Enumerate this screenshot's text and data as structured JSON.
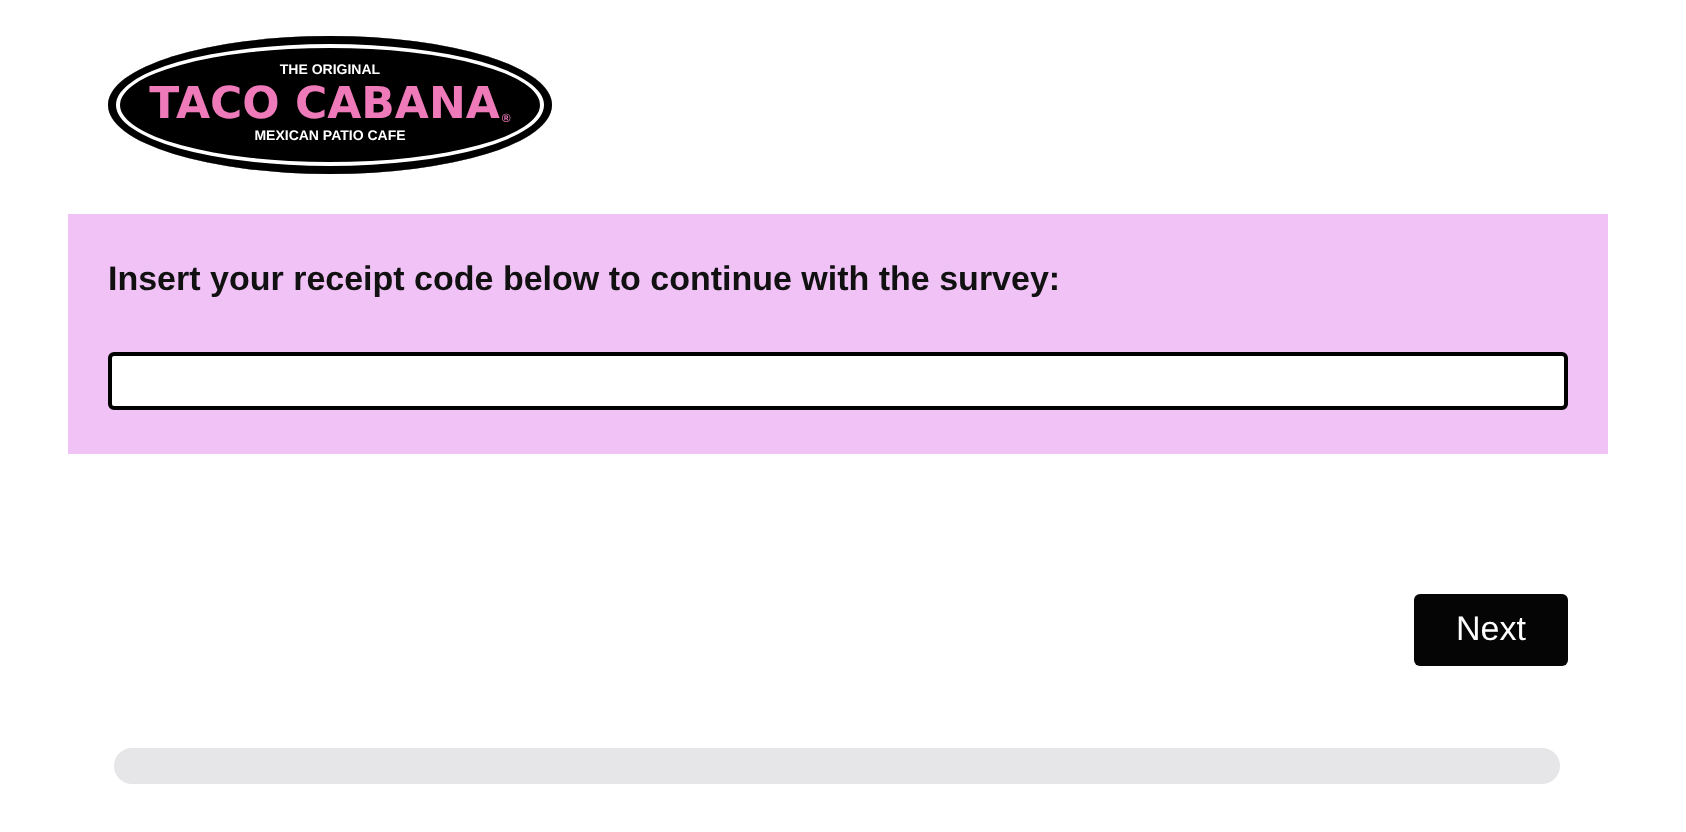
{
  "logo": {
    "top_line": "THE ORIGINAL",
    "name": "TACO CABANA",
    "mark": "®",
    "bottom_line": "MEXICAN PATIO CAFE"
  },
  "question": {
    "prompt": "Insert your receipt code below to continue with the survey:"
  },
  "next_button": "Next",
  "progress": {
    "level": 0
  }
}
